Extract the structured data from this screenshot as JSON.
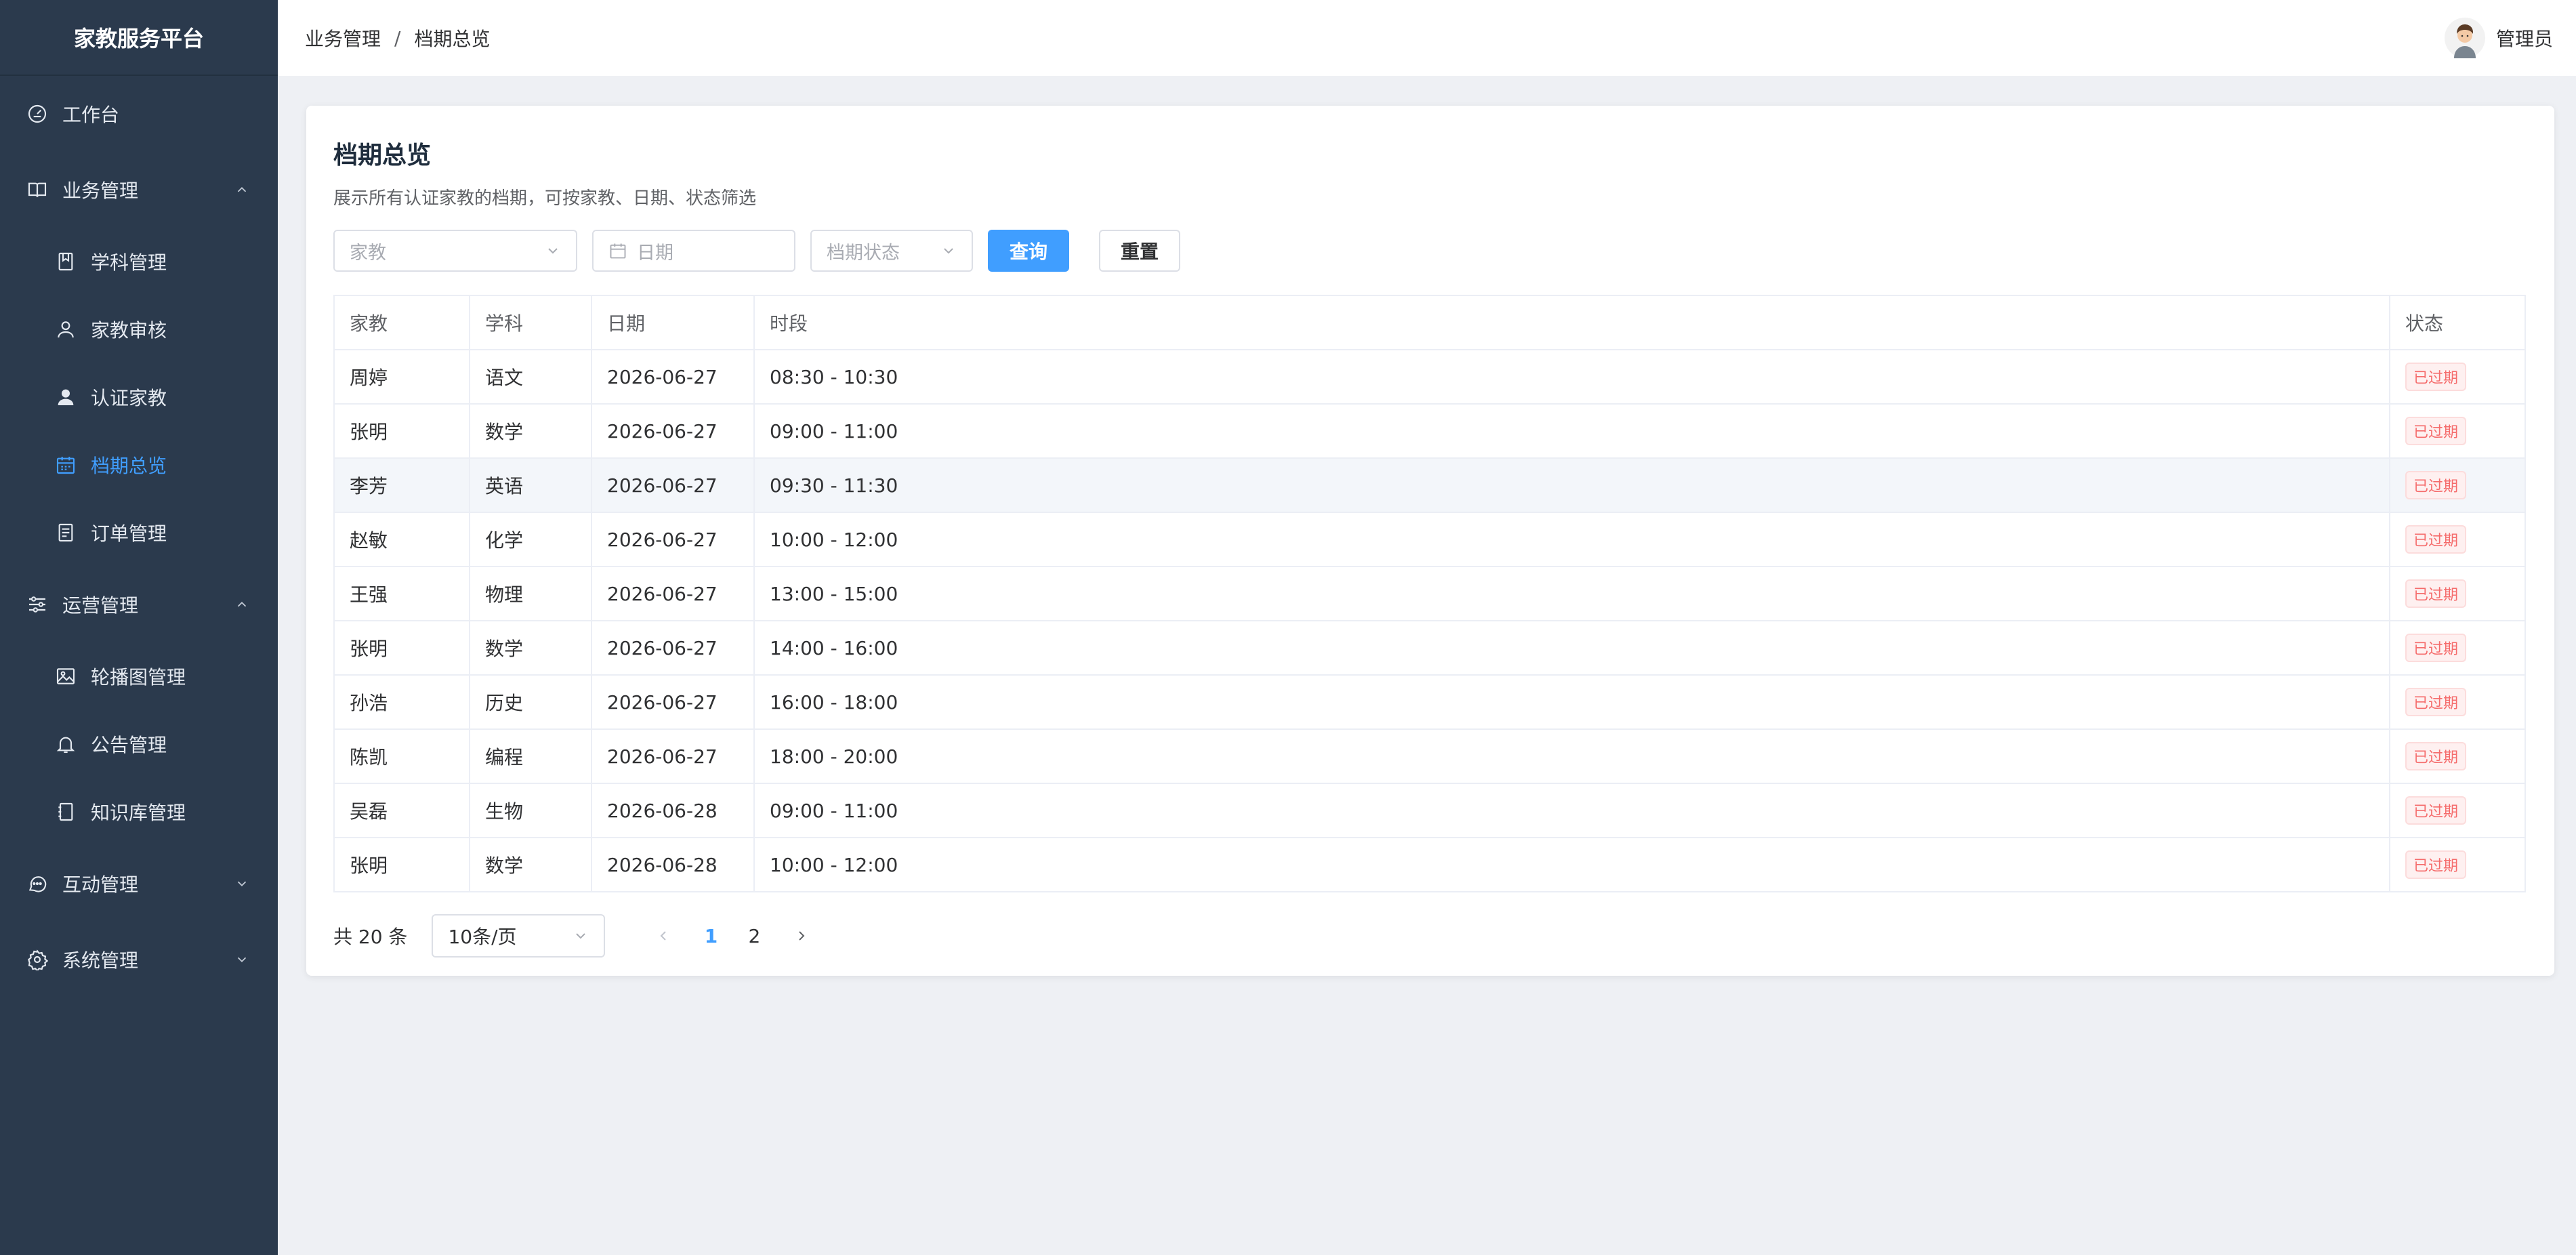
{
  "app": {
    "title": "家教服务平台"
  },
  "sidebar": {
    "items": [
      {
        "label": "工作台",
        "icon": "dashboard-icon",
        "level": 1
      },
      {
        "label": "业务管理",
        "icon": "book-icon",
        "level": 1,
        "expanded": true
      },
      {
        "label": "学科管理",
        "icon": "bookmark-icon",
        "level": 2
      },
      {
        "label": "家教审核",
        "icon": "user-outline-icon",
        "level": 2
      },
      {
        "label": "认证家教",
        "icon": "user-filled-icon",
        "level": 2
      },
      {
        "label": "档期总览",
        "icon": "calendar-icon",
        "level": 2,
        "active": true
      },
      {
        "label": "订单管理",
        "icon": "document-icon",
        "level": 2
      },
      {
        "label": "运营管理",
        "icon": "sliders-icon",
        "level": 1,
        "expanded": true
      },
      {
        "label": "轮播图管理",
        "icon": "image-icon",
        "level": 2
      },
      {
        "label": "公告管理",
        "icon": "bell-icon",
        "level": 2
      },
      {
        "label": "知识库管理",
        "icon": "notebook-icon",
        "level": 2
      },
      {
        "label": "互动管理",
        "icon": "chat-icon",
        "level": 1,
        "expanded": false
      },
      {
        "label": "系统管理",
        "icon": "gear-icon",
        "level": 1,
        "expanded": false
      }
    ]
  },
  "header": {
    "breadcrumb": [
      "业务管理",
      "档期总览"
    ],
    "separator": "/",
    "user_name": "管理员"
  },
  "main": {
    "title": "档期总览",
    "subtitle": "展示所有认证家教的档期，可按家教、日期、状态筛选",
    "filters": {
      "tutor_placeholder": "家教",
      "date_placeholder": "日期",
      "status_placeholder": "档期状态",
      "query_label": "查询",
      "reset_label": "重置"
    },
    "table": {
      "columns": [
        "家教",
        "学科",
        "日期",
        "时段",
        "状态"
      ],
      "rows": [
        [
          "周婷",
          "语文",
          "2026-06-27",
          "08:30 - 10:30",
          "已过期"
        ],
        [
          "张明",
          "数学",
          "2026-06-27",
          "09:00 - 11:00",
          "已过期"
        ],
        [
          "李芳",
          "英语",
          "2026-06-27",
          "09:30 - 11:30",
          "已过期"
        ],
        [
          "赵敏",
          "化学",
          "2026-06-27",
          "10:00 - 12:00",
          "已过期"
        ],
        [
          "王强",
          "物理",
          "2026-06-27",
          "13:00 - 15:00",
          "已过期"
        ],
        [
          "张明",
          "数学",
          "2026-06-27",
          "14:00 - 16:00",
          "已过期"
        ],
        [
          "孙浩",
          "历史",
          "2026-06-27",
          "16:00 - 18:00",
          "已过期"
        ],
        [
          "陈凯",
          "编程",
          "2026-06-27",
          "18:00 - 20:00",
          "已过期"
        ],
        [
          "吴磊",
          "生物",
          "2026-06-28",
          "09:00 - 11:00",
          "已过期"
        ],
        [
          "张明",
          "数学",
          "2026-06-28",
          "10:00 - 12:00",
          "已过期"
        ]
      ]
    },
    "pagination": {
      "total_text": "共 20 条",
      "page_size": "10条/页",
      "pages": [
        "1",
        "2"
      ],
      "current": "1"
    }
  },
  "colors": {
    "sidebar_bg": "#2b3a4d",
    "accent": "#409eff",
    "expired": "#f56c6c"
  }
}
